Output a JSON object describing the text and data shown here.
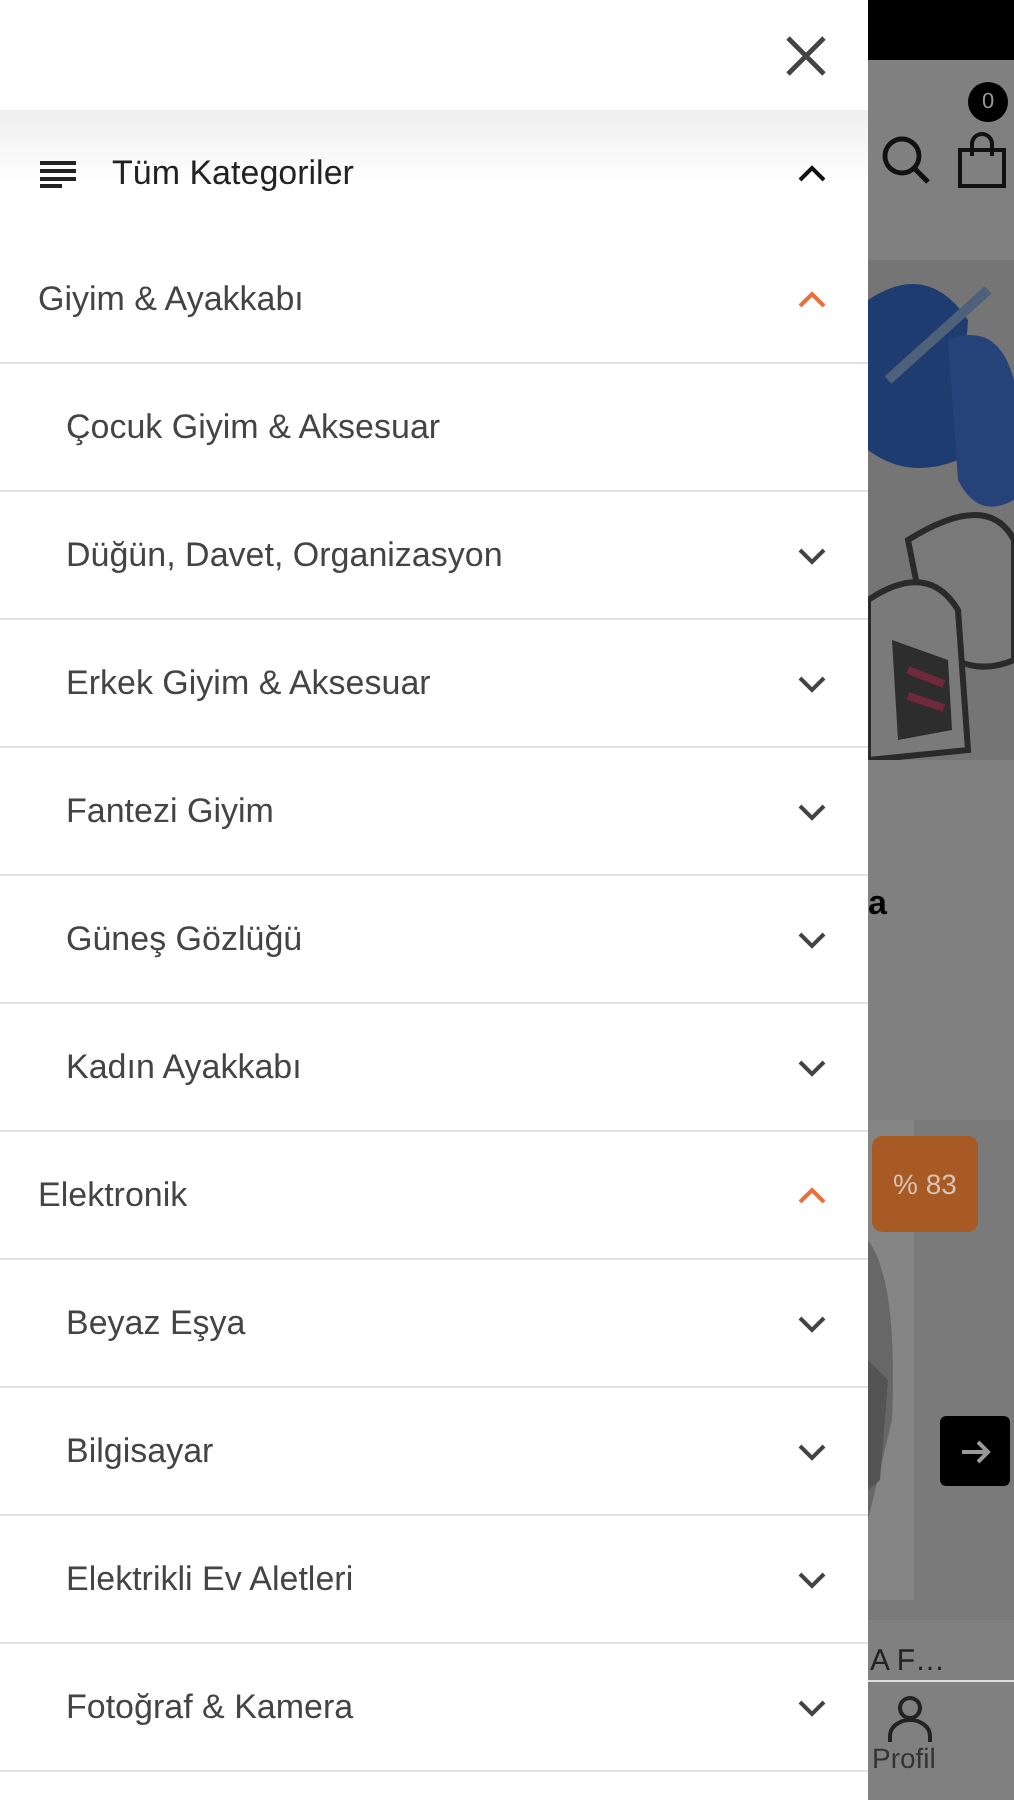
{
  "drawer": {
    "header": {
      "title": "Tüm Kategoriler",
      "expanded": true
    },
    "categories": [
      {
        "label": "Giyim & Ayakkabı",
        "expanded": true,
        "children": [
          {
            "label": "Çocuk Giyim & Aksesuar"
          },
          {
            "label": "Düğün, Davet, Organizasyon",
            "expanded": false
          },
          {
            "label": "Erkek Giyim & Aksesuar",
            "expanded": false
          },
          {
            "label": "Fantezi Giyim",
            "expanded": false
          },
          {
            "label": "Güneş Gözlüğü",
            "expanded": false
          },
          {
            "label": "Kadın Ayakkabı",
            "expanded": false
          }
        ]
      },
      {
        "label": "Elektronik",
        "expanded": true,
        "children": [
          {
            "label": "Beyaz Eşya",
            "expanded": false
          },
          {
            "label": "Bilgisayar",
            "expanded": false
          },
          {
            "label": "Elektrikli Ev Aletleri",
            "expanded": false
          },
          {
            "label": "Fotoğraf & Kamera",
            "expanded": false
          }
        ]
      }
    ]
  },
  "background": {
    "cart_count": "0",
    "text_fragment": "a",
    "discount_badge": "% 83",
    "product_name": "A F…",
    "nav_item": "Profil"
  }
}
